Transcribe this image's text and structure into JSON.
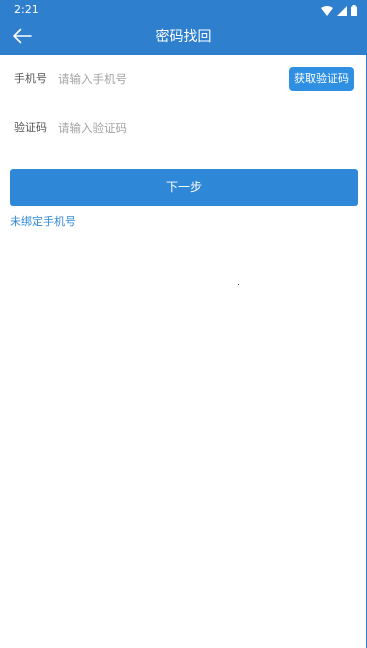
{
  "status_bar": {
    "time": "2:21",
    "icons": [
      "wifi-icon",
      "signal-icon",
      "battery-icon"
    ]
  },
  "app_bar": {
    "title": "密码找回",
    "back_icon": "back-arrow-icon"
  },
  "form": {
    "phone": {
      "label": "手机号",
      "placeholder": "请输入手机号",
      "value": ""
    },
    "code": {
      "label": "验证码",
      "placeholder": "请输入验证码",
      "value": ""
    },
    "get_code_button": "获取验证码",
    "next_button": "下一步",
    "unbound_link": "未绑定手机号"
  },
  "colors": {
    "primary": "#2f7fcf",
    "button": "#2f87d8",
    "code_button": "#2f8fe3",
    "label": "#555555",
    "placeholder": "#a3a3a3"
  }
}
